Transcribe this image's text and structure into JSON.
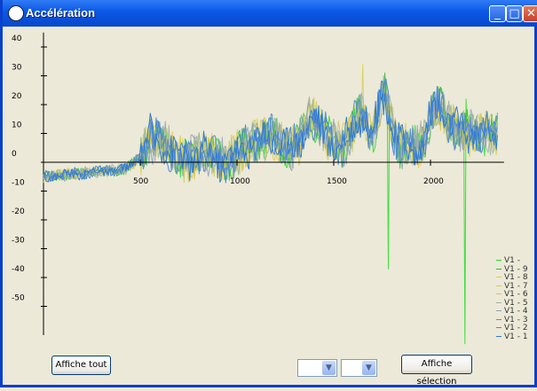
{
  "window": {
    "title": "Accélération"
  },
  "buttons": {
    "show_all": "Affiche tout",
    "show_selection": "Affiche sélection"
  },
  "combos": [
    {
      "value": ""
    },
    {
      "value": ""
    }
  ],
  "chart_data": {
    "type": "line",
    "xlim": [
      -10,
      2380
    ],
    "ylim": [
      -60,
      45
    ],
    "x_ticks": [
      500,
      1000,
      1500,
      2000
    ],
    "y_ticks": [
      40,
      30,
      20,
      10,
      0,
      -10,
      -20,
      -30,
      -40,
      -50
    ],
    "legend_position": "right",
    "series": [
      {
        "name": "V1 -",
        "color": "#22DD22"
      },
      {
        "name": "V1 - 9",
        "color": "#33BB33"
      },
      {
        "name": "V1 - 8",
        "color": "#D8D04A"
      },
      {
        "name": "V1 - 7",
        "color": "#E0C840"
      },
      {
        "name": "V1 - 6",
        "color": "#C8C860"
      },
      {
        "name": "V1 - 5",
        "color": "#9AB39A"
      },
      {
        "name": "V1 - 4",
        "color": "#8FA0B8"
      },
      {
        "name": "V1 - 3",
        "color": "#5E8EC0"
      },
      {
        "name": "V1 - 2",
        "color": "#4A8AD8"
      },
      {
        "name": "V1 - 1",
        "color": "#2F7BD0"
      }
    ]
  }
}
